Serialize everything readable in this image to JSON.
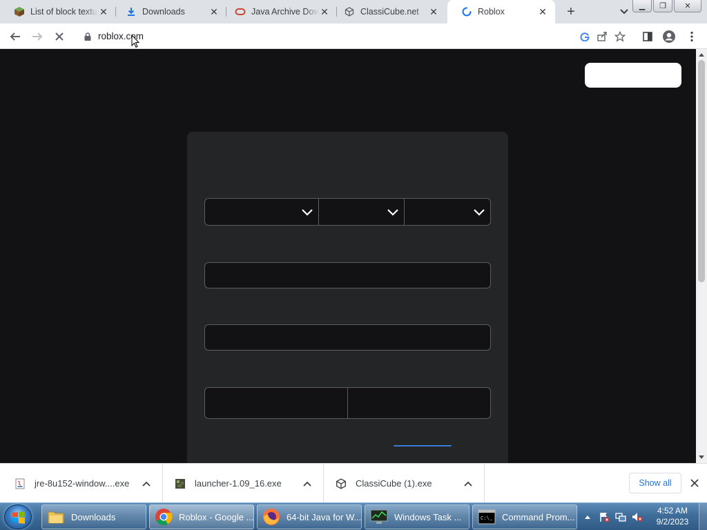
{
  "browser": {
    "tabs": [
      {
        "title": "List of block textu",
        "favicon": "minecraft-block-icon",
        "active": false
      },
      {
        "title": "Downloads",
        "favicon": "download-icon",
        "active": false
      },
      {
        "title": "Java Archive Down",
        "favicon": "oracle-icon",
        "active": false
      },
      {
        "title": "ClassiCube.net",
        "favicon": "classicube-icon",
        "active": false
      },
      {
        "title": "Roblox",
        "favicon": "loading-spinner-icon",
        "active": true
      }
    ],
    "address": "roblox.com",
    "loading": true
  },
  "downloads": {
    "items": [
      {
        "filename": "jre-8u152-window....exe",
        "icon": "java-file-icon"
      },
      {
        "filename": "launcher-1.09_16.exe",
        "icon": "minecraft-launcher-icon"
      },
      {
        "filename": "ClassiCube (1).exe",
        "icon": "classicube-icon"
      }
    ],
    "show_all_label": "Show all"
  },
  "taskbar": {
    "items": [
      {
        "label": "Downloads",
        "icon": "folder-icon"
      },
      {
        "label": "Roblox - Google ...",
        "icon": "chrome-icon"
      },
      {
        "label": "64-bit Java for W...",
        "icon": "firefox-icon"
      },
      {
        "label": "Windows Task ...",
        "icon": "task-manager-icon"
      },
      {
        "label": "Command Prom...",
        "icon": "cmd-icon"
      }
    ],
    "clock_time": "4:52 AM",
    "clock_date": "9/2/2023"
  },
  "colors": {
    "page_bg": "#121215",
    "card_bg": "#232527",
    "link_accent": "#3a7bd5"
  }
}
